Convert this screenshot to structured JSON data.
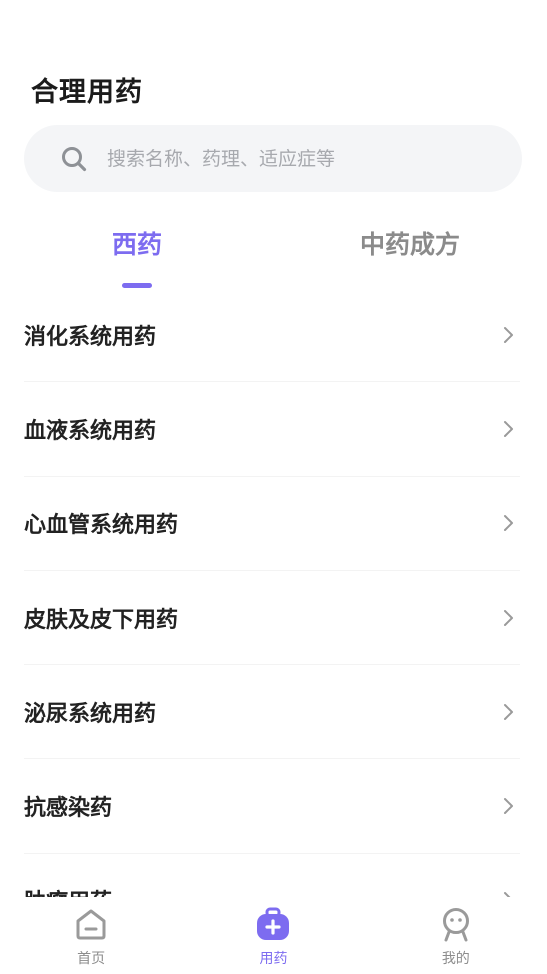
{
  "header": {
    "title": "合理用药"
  },
  "search": {
    "placeholder": "搜索名称、药理、适应症等",
    "icon": "search-icon"
  },
  "tabs": [
    {
      "label": "西药",
      "active": true
    },
    {
      "label": "中药成方",
      "active": false
    }
  ],
  "categories": [
    {
      "label": "消化系统用药"
    },
    {
      "label": "血液系统用药"
    },
    {
      "label": "心血管系统用药"
    },
    {
      "label": "皮肤及皮下用药"
    },
    {
      "label": "泌尿系统用药"
    },
    {
      "label": "抗感染药"
    },
    {
      "label": "肿瘤用药"
    }
  ],
  "bottom_nav": [
    {
      "label": "首页",
      "icon": "home-icon",
      "active": false
    },
    {
      "label": "用药",
      "icon": "medicine-kit-icon",
      "active": true
    },
    {
      "label": "我的",
      "icon": "profile-icon",
      "active": false
    }
  ],
  "colors": {
    "accent": "#7d6cf0",
    "inactive_tab": "#8b8b8b",
    "search_bg": "#f4f5f7",
    "nav_inactive": "#8c8c8c"
  }
}
